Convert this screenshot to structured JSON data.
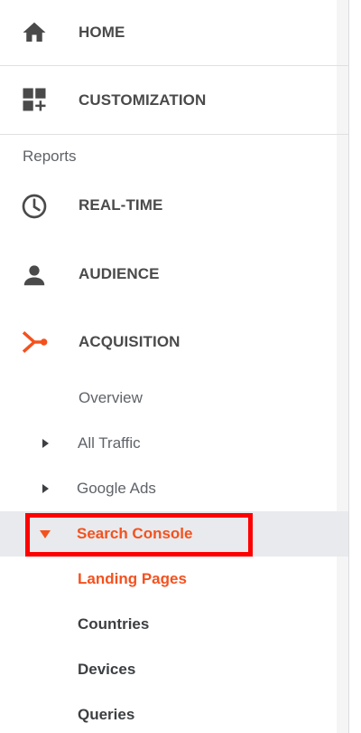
{
  "nav": {
    "home_label": "HOME",
    "customization_label": "CUSTOMIZATION",
    "reports_header": "Reports",
    "realtime_label": "REAL-TIME",
    "audience_label": "AUDIENCE",
    "acquisition_label": "ACQUISITION",
    "acquisition_children": {
      "overview": "Overview",
      "all_traffic": "All Traffic",
      "google_ads": "Google Ads",
      "search_console": "Search Console"
    },
    "search_console_children": {
      "landing_pages": "Landing Pages",
      "countries": "Countries",
      "devices": "Devices",
      "queries": "Queries"
    }
  },
  "colors": {
    "accent": "#f4511e",
    "highlight_border": "#ff0000",
    "selected_background": "#e8eaed",
    "icon_gray": "#4a4a4a"
  },
  "icons": {
    "home": "home-icon",
    "customization": "dashboard-plus-icon",
    "realtime": "clock-icon",
    "audience": "person-icon",
    "acquisition": "acquisition-fork-icon"
  }
}
